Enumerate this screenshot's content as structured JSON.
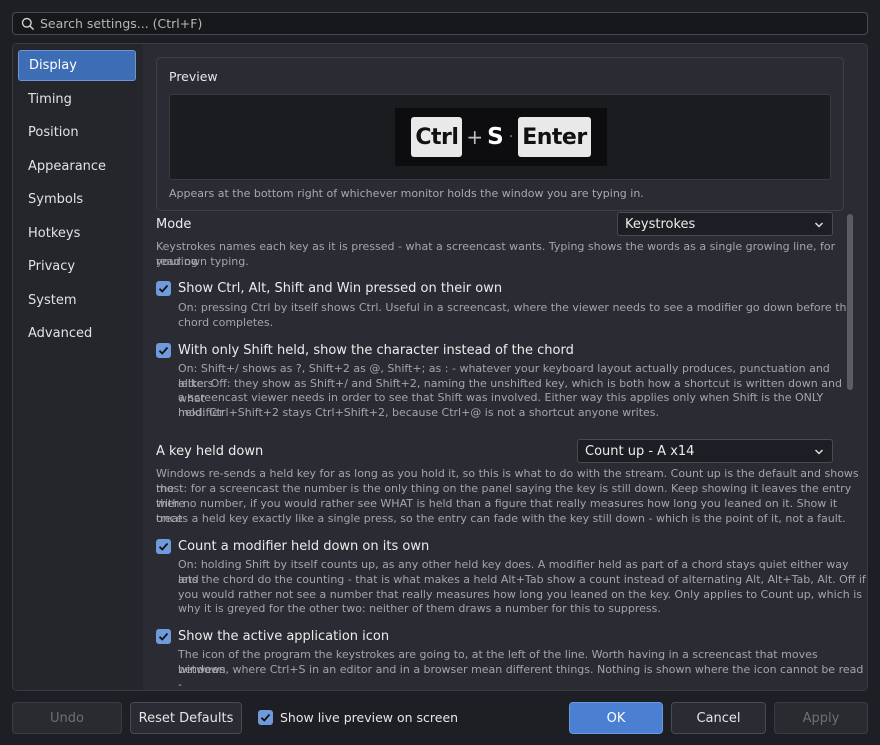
{
  "search": {
    "placeholder": "Search settings... (Ctrl+F)"
  },
  "sidebar": {
    "items": [
      {
        "label": "Display",
        "active": true
      },
      {
        "label": "Timing"
      },
      {
        "label": "Position"
      },
      {
        "label": "Appearance"
      },
      {
        "label": "Symbols"
      },
      {
        "label": "Hotkeys"
      },
      {
        "label": "Privacy"
      },
      {
        "label": "System"
      },
      {
        "label": "Advanced"
      }
    ]
  },
  "preview": {
    "title": "Preview",
    "keys": [
      "Ctrl",
      "+",
      "S",
      "·",
      "Enter"
    ],
    "note": "Appears at the bottom right of whichever monitor holds the window you are typing in."
  },
  "settings": {
    "mode": {
      "label": "Mode",
      "value": "Keystrokes",
      "desc1": "Keystrokes names each key as it is pressed - what a screencast wants. Typing shows the words as a single growing line, for reading",
      "desc2": "your own typing."
    },
    "show_mods": {
      "label": "Show Ctrl, Alt, Shift and Win pressed on their own",
      "checked": true,
      "desc1": "On: pressing Ctrl by itself shows Ctrl. Useful in a screencast, where the viewer needs to see a modifier go down before the",
      "desc2": "chord completes."
    },
    "shift_char": {
      "label": "With only Shift held, show the character instead of the chord",
      "checked": true,
      "desc1": "On: Shift+/ shows as ?, Shift+2 as @, Shift+; as : - whatever your keyboard layout actually produces, punctuation and letters",
      "desc2": "alike. Off: they show as Shift+/ and Shift+2, naming the unshifted key, which is both how a shortcut is written down and what",
      "desc3": "a screencast viewer needs in order to see that Shift was involved. Either way this applies only when Shift is the ONLY modifier",
      "desc4": "held: Ctrl+Shift+2 stays Ctrl+Shift+2, because Ctrl+@ is not a shortcut anyone writes."
    },
    "held": {
      "label": "A key held down",
      "value": "Count up - A x14",
      "desc1": "Windows re-sends a held key for as long as you hold it, so this is what to do with the stream. Count up is the default and shows the",
      "desc2": "most: for a screencast the number is the only thing on the panel saying the key is still down. Keep showing it leaves the entry there",
      "desc3": "with no number, if you would rather see WHAT is held than a figure that really measures how long you leaned on it. Show it once",
      "desc4": "treats a held key exactly like a single press, so the entry can fade with the key still down - which is the point of it, not a fault."
    },
    "count_mod": {
      "label": "Count a modifier held down on its own",
      "checked": true,
      "desc1": "On: holding Shift by itself counts up, as any other held key does. A modifier held as part of a chord stays quiet either way and",
      "desc2": "lets the chord do the counting - that is what makes a held Alt+Tab show a count instead of alternating Alt, Alt+Tab, Alt. Off if",
      "desc3": "you would rather not see a number that really measures how long you leaned on the key. Only applies to Count up, which is",
      "desc4": "why it is greyed for the other two: neither of them draws a number for this to suppress."
    },
    "app_icon": {
      "label": "Show the active application icon",
      "checked": true,
      "desc1": "The icon of the program the keystrokes are going to, at the left of the line. Worth having in a screencast that moves between",
      "desc2": "windows, where Ctrl+S in an editor and in a browser mean different things. Nothing is shown where the icon cannot be read -"
    }
  },
  "footer": {
    "undo": "Undo",
    "reset": "Reset Defaults",
    "live_preview": "Show live preview on screen",
    "live_preview_checked": true,
    "ok": "OK",
    "cancel": "Cancel",
    "apply": "Apply"
  },
  "colors": {
    "accent": "#4a7fd1",
    "checkbox": "#6f9bdc",
    "background": "#1e1f24",
    "content": "#2b2c33"
  }
}
